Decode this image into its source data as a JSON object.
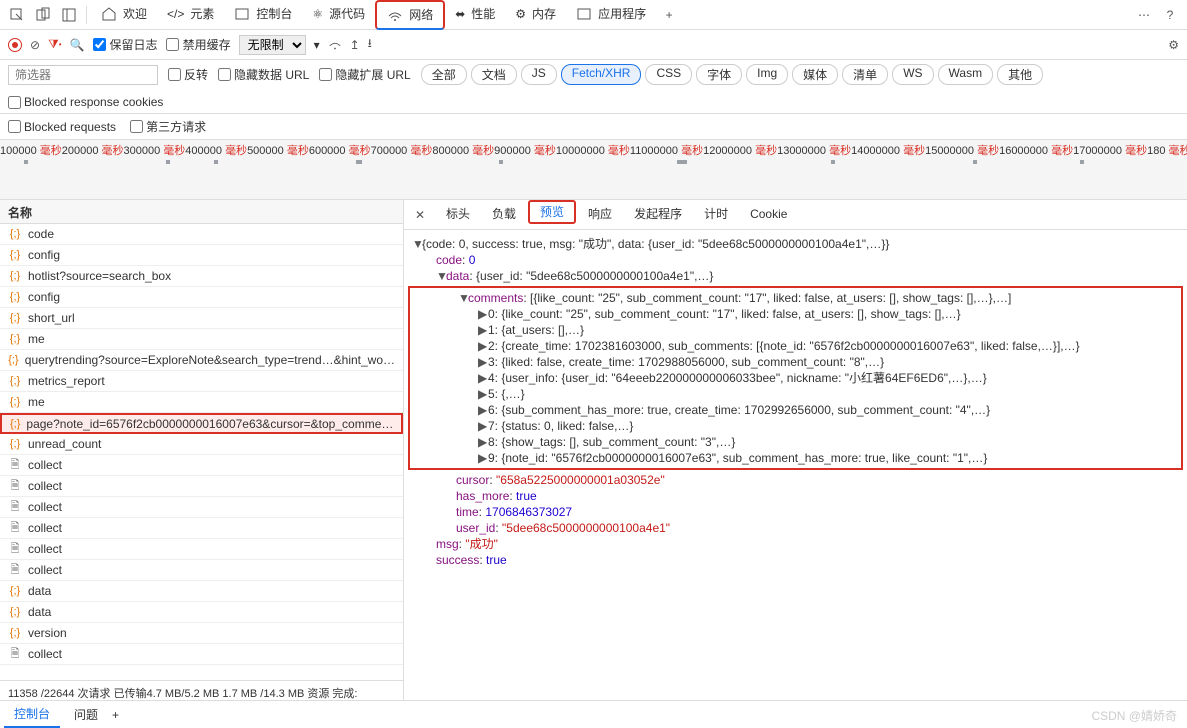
{
  "top": {
    "tabs": [
      "欢迎",
      "元素",
      "控制台",
      "源代码",
      "网络",
      "性能",
      "内存",
      "应用程序"
    ],
    "active_index": 4
  },
  "toolbar": {
    "preserve_log": "保留日志",
    "disable_cache": "禁用缓存",
    "throttle": "无限制"
  },
  "filter": {
    "placeholder": "筛选器",
    "invert": "反转",
    "hide_data_urls": "隐藏数据 URL",
    "hide_ext_urls": "隐藏扩展 URL",
    "pills": [
      "全部",
      "文档",
      "JS",
      "Fetch/XHR",
      "CSS",
      "字体",
      "Img",
      "媒体",
      "清单",
      "WS",
      "Wasm",
      "其他"
    ],
    "active_pill": 3,
    "blocked_cookies": "Blocked response cookies",
    "blocked_requests": "Blocked requests",
    "third_party": "第三方请求"
  },
  "timeline": {
    "ticks": [
      "100000",
      "200000",
      "300000",
      "400000",
      "500000",
      "600000",
      "700000",
      "800000",
      "900000",
      "10000000",
      "11000000",
      "12000000",
      "13000000",
      "14000000",
      "15000000",
      "16000000",
      "17000000",
      "180"
    ],
    "unit": "毫秒"
  },
  "left": {
    "header": "名称",
    "items": [
      {
        "icon": "json",
        "name": "code"
      },
      {
        "icon": "json",
        "name": "config"
      },
      {
        "icon": "json",
        "name": "hotlist?source=search_box"
      },
      {
        "icon": "json",
        "name": "config"
      },
      {
        "icon": "json",
        "name": "short_url"
      },
      {
        "icon": "json",
        "name": "me"
      },
      {
        "icon": "json",
        "name": "querytrending?source=ExploreNote&search_type=trend…&hint_wo…"
      },
      {
        "icon": "json",
        "name": "metrics_report"
      },
      {
        "icon": "json",
        "name": "me"
      },
      {
        "icon": "json",
        "name": "page?note_id=6576f2cb0000000016007e63&cursor=&top_comme…",
        "selected": true
      },
      {
        "icon": "json",
        "name": "unread_count"
      },
      {
        "icon": "doc",
        "name": "collect"
      },
      {
        "icon": "doc",
        "name": "collect"
      },
      {
        "icon": "doc",
        "name": "collect"
      },
      {
        "icon": "doc",
        "name": "collect"
      },
      {
        "icon": "doc",
        "name": "collect"
      },
      {
        "icon": "doc",
        "name": "collect"
      },
      {
        "icon": "json",
        "name": "data"
      },
      {
        "icon": "json",
        "name": "data"
      },
      {
        "icon": "json",
        "name": "version"
      },
      {
        "icon": "doc",
        "name": "collect"
      }
    ],
    "status": "11358 /22644 次请求   已传输4.7 MB/5.2 MB   1.7 MB /14.3 MB 资源   完成:"
  },
  "preview": {
    "tabs": [
      "标头",
      "负载",
      "预览",
      "响应",
      "发起程序",
      "计时",
      "Cookie"
    ],
    "active_index": 2,
    "json": {
      "summary": "{code: 0, success: true, msg: \"成功\", data: {user_id: \"5dee68c5000000000100a4e1\",…}}",
      "code": "0",
      "data_summary": "{user_id: \"5dee68c5000000000100a4e1\",…}",
      "comments_summary": "[{like_count: \"25\", sub_comment_count: \"17\", liked: false, at_users: [], show_tags: [],…},…]",
      "rows": [
        "0: {like_count: \"25\", sub_comment_count: \"17\", liked: false, at_users: [], show_tags: [],…}",
        "1: {at_users: [],…}",
        "2: {create_time: 1702381603000, sub_comments: [{note_id: \"6576f2cb0000000016007e63\", liked: false,…}],…}",
        "3: {liked: false, create_time: 1702988056000, sub_comment_count: \"8\",…}",
        "4: {user_info: {user_id: \"64eeeb220000000006033bee\", nickname: \"小红薯64EF6ED6\",…},…}",
        "5: {,…}",
        "6: {sub_comment_has_more: true, create_time: 1702992656000, sub_comment_count: \"4\",…}",
        "7: {status: 0, liked: false,…}",
        "8: {show_tags: [], sub_comment_count: \"3\",…}",
        "9: {note_id: \"6576f2cb0000000016007e63\", sub_comment_has_more: true, like_count: \"1\",…}"
      ],
      "cursor": "\"658a5225000000001a03052e\"",
      "has_more": "true",
      "time": "1706846373027",
      "user_id": "\"5dee68c5000000000100a4e1\"",
      "msg": "\"成功\"",
      "success": "true"
    }
  },
  "footer": {
    "tabs": [
      "控制台",
      "问题"
    ],
    "active": 0
  },
  "watermark": "CSDN @婧娇奇"
}
